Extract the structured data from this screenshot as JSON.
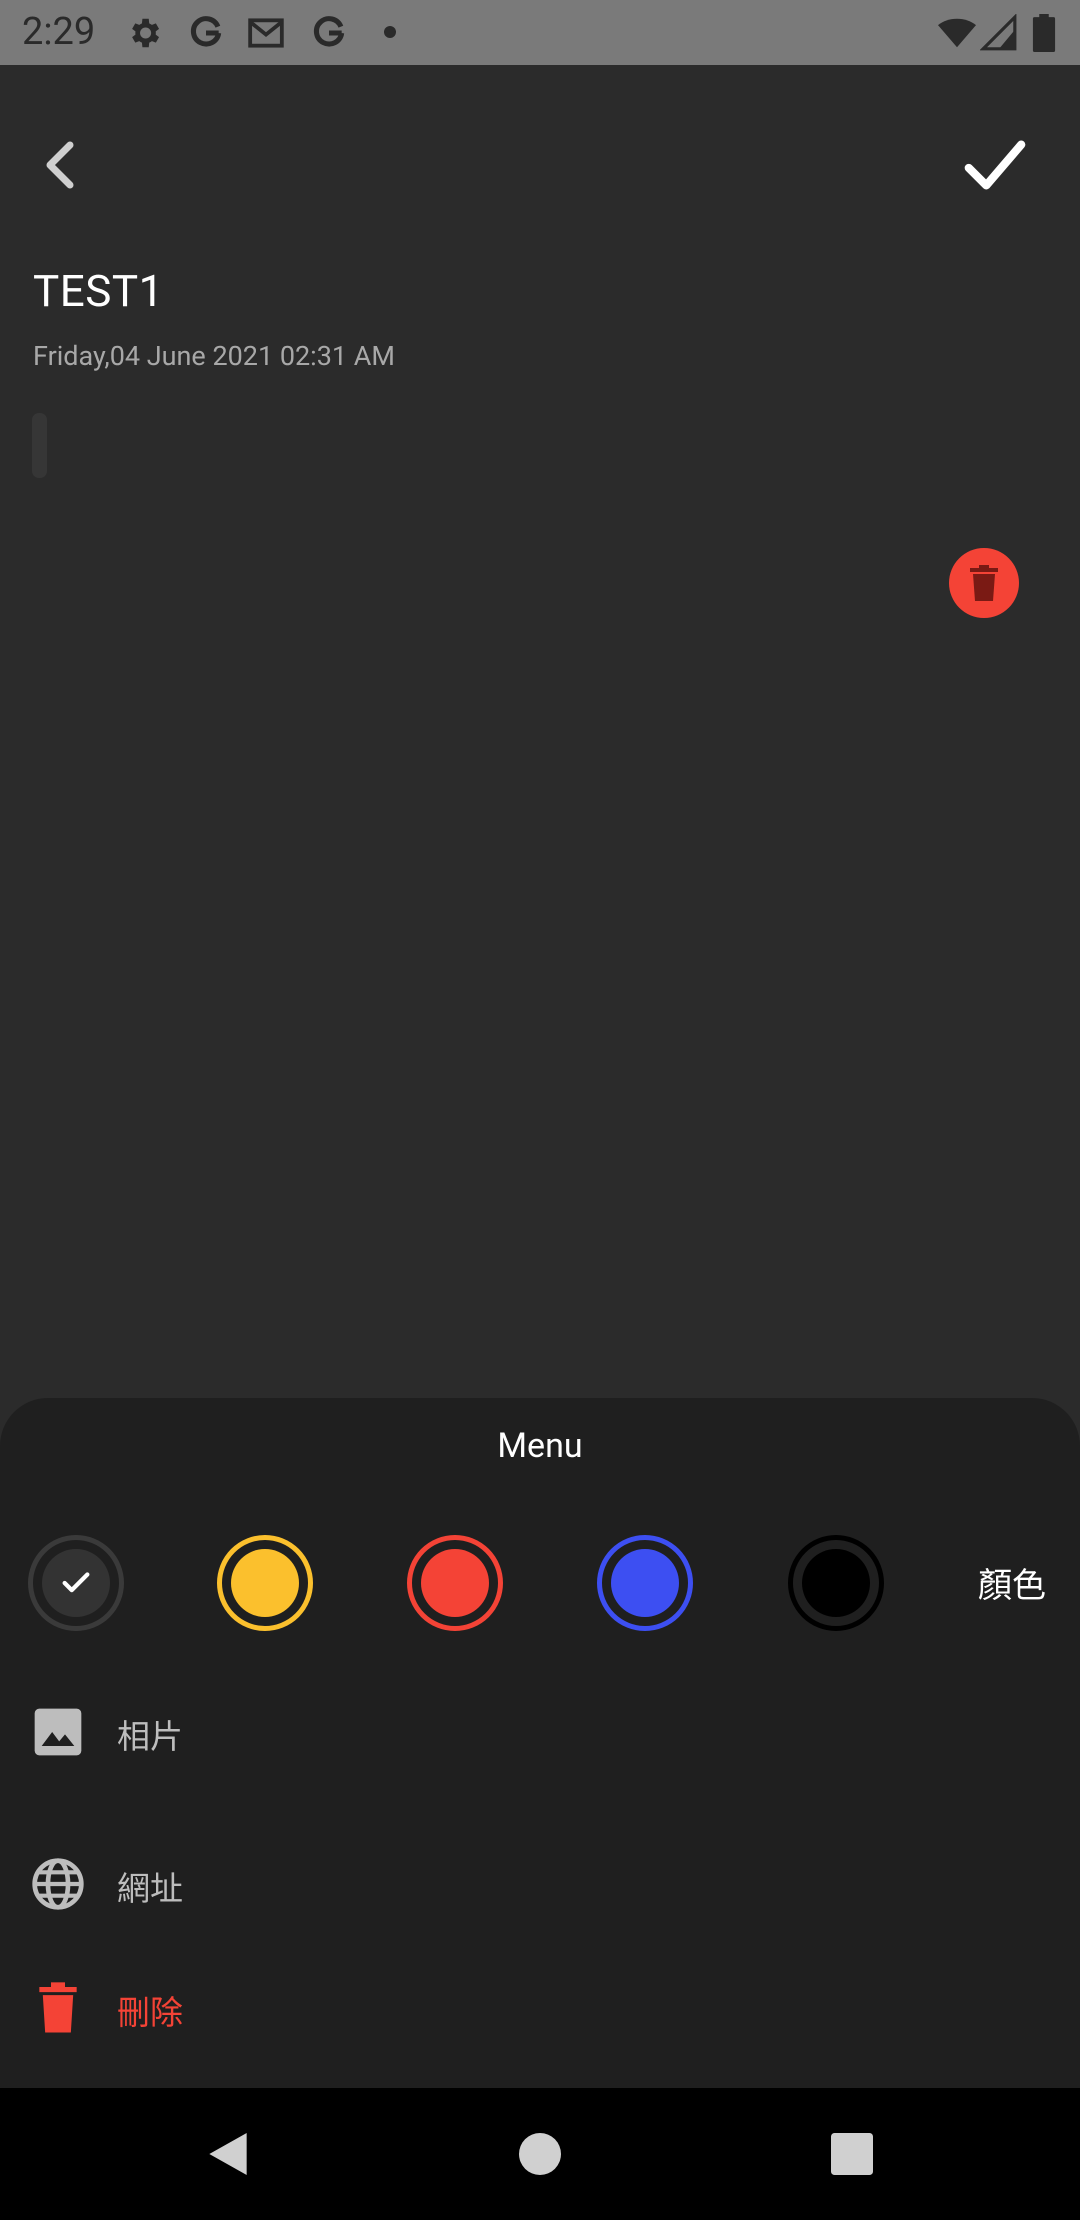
{
  "status_bar": {
    "time": "2:29",
    "icons": [
      "settings-icon",
      "google-icon",
      "gmail-icon",
      "google-icon",
      "notification-dot",
      "wifi-icon",
      "signal-icon",
      "battery-icon"
    ]
  },
  "toolbar": {
    "back_icon": "chevron-left-icon",
    "save_icon": "check-icon"
  },
  "note": {
    "title": "TEST1",
    "date": "Friday,04 June 2021 02:31 AM"
  },
  "menu": {
    "title": "Menu",
    "color_label": "顏色",
    "colors": [
      {
        "name": "default",
        "hex": "#333333",
        "ring": "#3a3a3a",
        "selected": true
      },
      {
        "name": "yellow",
        "hex": "#fbc02d",
        "ring": "#fbc02d",
        "selected": false
      },
      {
        "name": "red",
        "hex": "#f44336",
        "ring": "#f44336",
        "selected": false
      },
      {
        "name": "blue",
        "hex": "#3d4ff2",
        "ring": "#3d4ff2",
        "selected": false
      },
      {
        "name": "black",
        "hex": "#000000",
        "ring": "#000000",
        "selected": false
      }
    ],
    "items": [
      {
        "id": "photo",
        "label": "相片",
        "icon": "image-icon"
      },
      {
        "id": "url",
        "label": "網址",
        "icon": "globe-icon"
      },
      {
        "id": "delete",
        "label": "刪除",
        "icon": "trash-icon"
      }
    ]
  },
  "colors": {
    "background": "#2b2b2b",
    "sheet": "#1f1f1f",
    "danger": "#f44336"
  }
}
